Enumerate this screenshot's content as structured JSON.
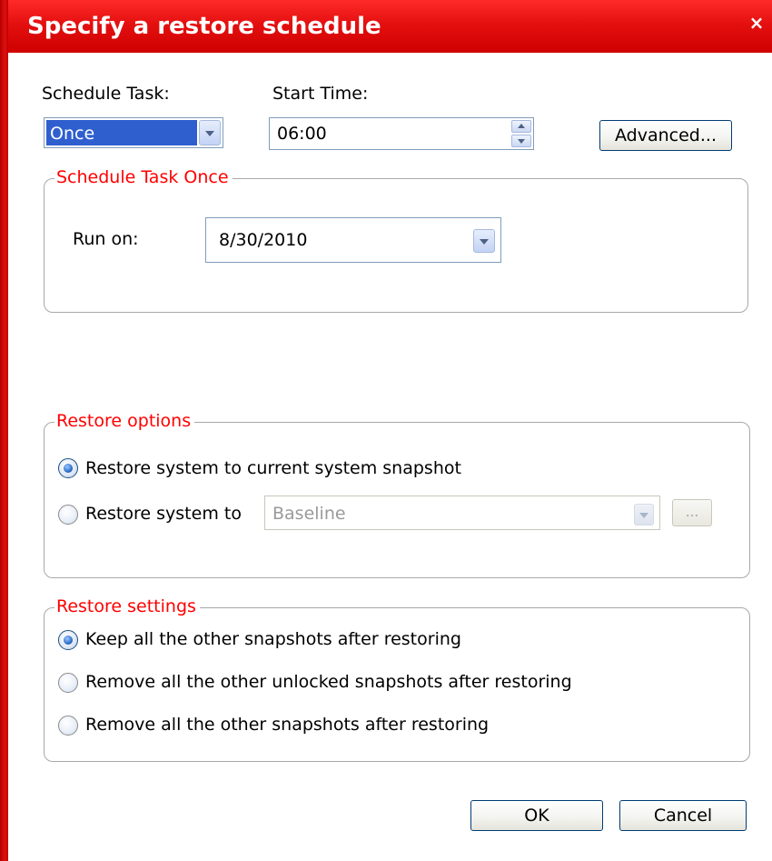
{
  "window": {
    "title": "Specify a restore schedule",
    "close_glyph": "×"
  },
  "schedule": {
    "task_label": "Schedule Task:",
    "task_value": "Once",
    "start_label": "Start Time:",
    "start_value": "06:00",
    "advanced_button": "Advanced..."
  },
  "once_group": {
    "legend": "Schedule Task Once",
    "run_on_label": "Run on:",
    "run_on_value": "8/30/2010"
  },
  "restore_options": {
    "legend": "Restore options",
    "option_current": "Restore system to current system snapshot",
    "option_to": "Restore system to",
    "snapshot_value": "Baseline",
    "browse_label": "...",
    "selected": "option_current"
  },
  "restore_settings": {
    "legend": "Restore settings",
    "options": [
      "Keep all the other snapshots after restoring",
      "Remove all the other unlocked snapshots after restoring",
      "Remove all the other snapshots after restoring"
    ],
    "selected_index": 0
  },
  "buttons": {
    "ok": "OK",
    "cancel": "Cancel"
  },
  "colors": {
    "titlebar": "#e41010",
    "legend_text": "#ff0000",
    "selection": "#2f5fcf"
  },
  "icons": {
    "close": "close-icon",
    "dropdown": "chevron-down-icon",
    "spin_up": "spin-up-icon",
    "spin_down": "spin-down-icon"
  }
}
